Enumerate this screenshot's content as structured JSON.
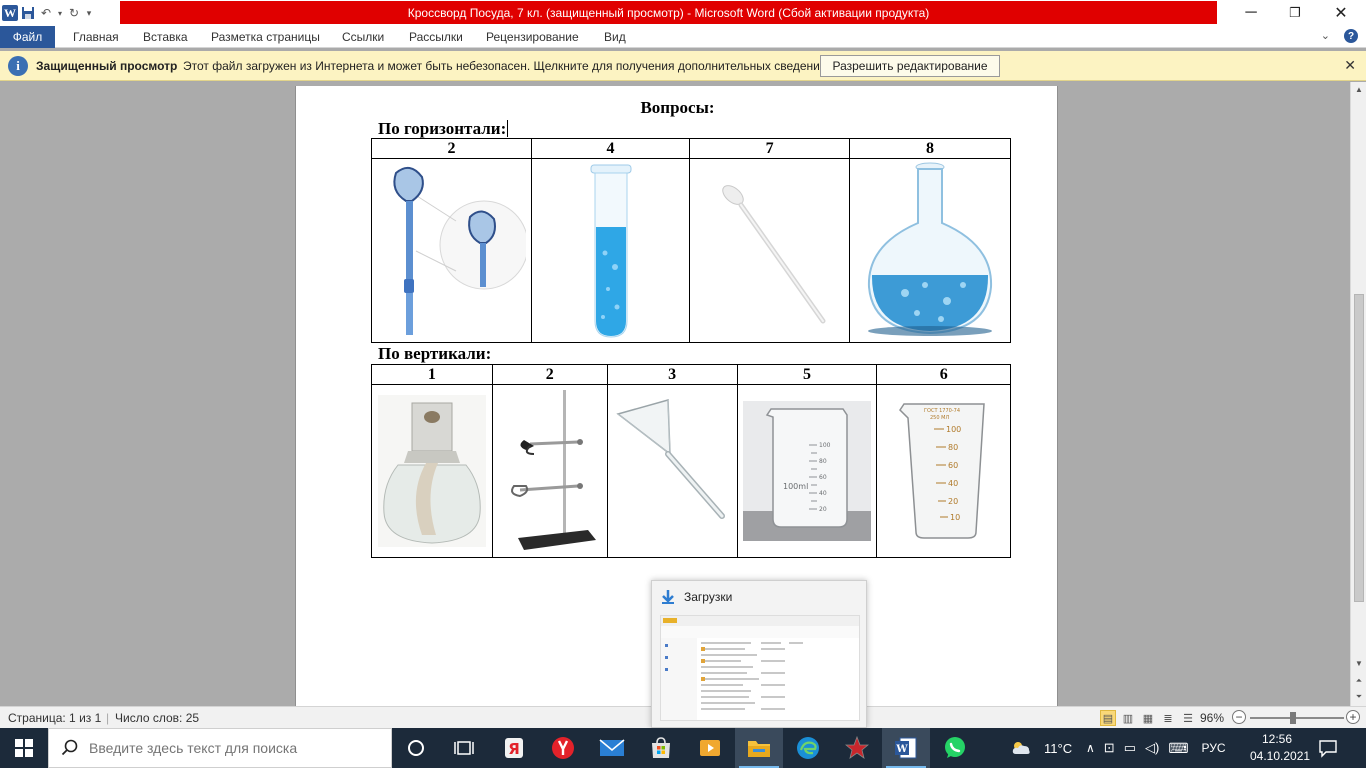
{
  "window": {
    "title": "Кроссворд Посуда, 7 кл. (защищенный просмотр)  -  Microsoft Word (Сбой активации продукта)",
    "minimize_label": "─",
    "restore_label": "❐",
    "close_label": "✕"
  },
  "ribbon": {
    "tabs": [
      "Файл",
      "Главная",
      "Вставка",
      "Разметка страницы",
      "Ссылки",
      "Рассылки",
      "Рецензирование",
      "Вид"
    ]
  },
  "protected_view": {
    "title": "Защищенный просмотр",
    "message": "Этот файл загружен из Интернета и может быть небезопасен. Щелкните для получения дополнительных сведений.",
    "button": "Разрешить редактирование",
    "close": "✕"
  },
  "document": {
    "heading": "Вопросы:",
    "horizontal": {
      "label": "По горизонтали:",
      "numbers": [
        "2",
        "4",
        "7",
        "8"
      ],
      "images": [
        "spoon-spatula-image",
        "test-tube-image",
        "pipette-image",
        "round-flask-image"
      ]
    },
    "vertical": {
      "label": "По вертикали:",
      "numbers": [
        "1",
        "2",
        "3",
        "5",
        "6"
      ],
      "images": [
        "spirit-lamp-image",
        "lab-stand-image",
        "funnel-image",
        "beaker-image",
        "measuring-cup-image"
      ],
      "beaker_label": "100ml",
      "beaker_marks": [
        "100",
        "80",
        "60",
        "40",
        "20"
      ],
      "cup_header": "ГОСТ 1770-74",
      "cup_volume": "250 МЛ",
      "cup_marks": [
        "100",
        "80",
        "60",
        "40",
        "20",
        "10"
      ]
    }
  },
  "statusbar": {
    "page": "Страница: 1 из 1",
    "words": "Число слов: 25",
    "zoom": "96%",
    "zoom_percent": 96
  },
  "thumbnail_popup": {
    "title": "Загрузки"
  },
  "taskbar": {
    "search_placeholder": "Введите здесь текст для поиска",
    "weather": "11°C",
    "language": "РУС",
    "time": "12:56",
    "date": "04.10.2021"
  },
  "colors": {
    "word_blue": "#2b579a",
    "title_red": "#e00000",
    "protected_bar": "#fcf3c2",
    "taskbar": "#1c2a3a"
  }
}
